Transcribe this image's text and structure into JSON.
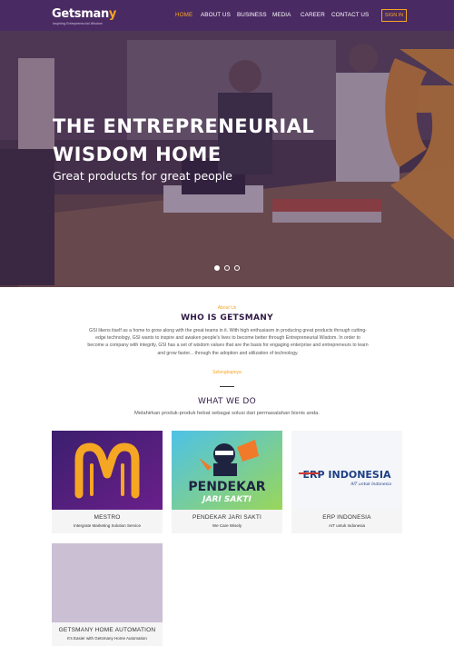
{
  "brand": {
    "name_main": "Getsman",
    "name_accent": "y",
    "tagline": "Inspiring Entrepreneurial Wisdom"
  },
  "nav": {
    "items": [
      {
        "label": "HOME",
        "active": true
      },
      {
        "label": "ABOUT US",
        "active": false
      },
      {
        "label": "BUSINESS",
        "active": false
      },
      {
        "label": "MEDIA",
        "active": false
      },
      {
        "label": "CAREER",
        "active": false
      },
      {
        "label": "CONTACT US",
        "active": false
      }
    ],
    "signin": "SIGN IN"
  },
  "hero": {
    "title": "THE ENTREPRENEURIAL WISDOM HOME",
    "subtitle": "Great products for great people",
    "slide_count": 3,
    "active_slide": 1
  },
  "about": {
    "label": "About Us",
    "title": "WHO IS GETSMANY",
    "text": "GSI likens itself as a home to grow along with the great teams in it. With high enthusiasm in producing great products through cutting-edge technology, GSI wants to inspire and awaken people's lives to become better through Entrepreneurial Wisdom. In order to become a company with integrity, GSI has a set of wisdom values that are the basis for engaging enterprise and entrepreneurs to learn and grow faster... through the adoption and utilization of technology.",
    "readmore": "Selengkapnya"
  },
  "what_we_do": {
    "title": "WHAT WE DO",
    "subtitle": "Melahirkan produk-produk hebat sebagai solusi dari permasalahan bisnis anda."
  },
  "products": [
    {
      "name": "MESTRO",
      "desc": "Intergrate Marketing Solution Service"
    },
    {
      "name": "PENDEKAR JARI SAKTI",
      "desc": "We Care Wisely",
      "logo_line1": "PENDEKAR",
      "logo_line2": "JARI SAKTI"
    },
    {
      "name": "ERP INDONESIA",
      "desc": "AIT untuk Indonesia",
      "logo_main": "ERP INDONESIA",
      "logo_sub": "AIT untuk Indonesia"
    },
    {
      "name": "GETSMANY HOME AUTOMATION",
      "desc": "It's Easier with Getsmany Home Automation"
    }
  ],
  "colors": {
    "nav_bg": "#4a2a63",
    "accent": "#f5a623",
    "heading": "#2e1a44"
  }
}
